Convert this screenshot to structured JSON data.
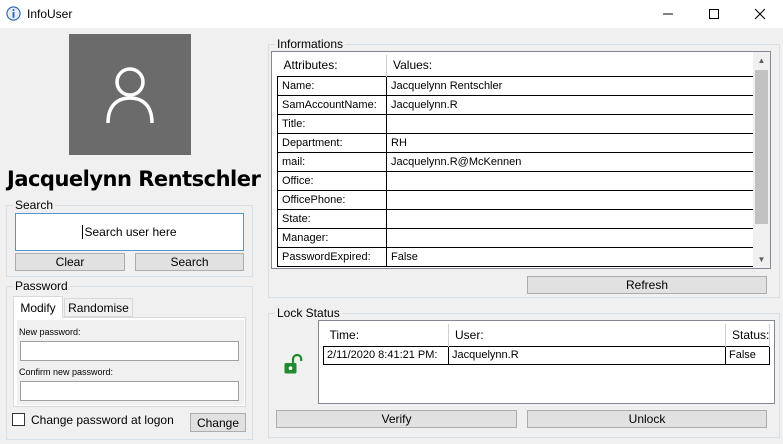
{
  "window": {
    "title": "InfoUser",
    "icon": "info-icon",
    "controls": [
      "minimize",
      "maximize",
      "close"
    ]
  },
  "user": {
    "avatar_icon": "user-silhouette-icon",
    "name": "Jacquelynn Rentschler"
  },
  "search": {
    "group_label": "Search",
    "placeholder": "Search user here",
    "clear_label": "Clear",
    "search_label": "Search"
  },
  "password": {
    "group_label": "Password",
    "tabs": [
      {
        "label": "Modify",
        "selected": true
      },
      {
        "label": "Randomise",
        "selected": false
      }
    ],
    "new_label": "New password:",
    "new_value": "",
    "confirm_label": "Confirm new password:",
    "confirm_value": "",
    "change_at_logon_label": "Change password at logon",
    "change_at_logon_checked": false,
    "change_label": "Change"
  },
  "informations": {
    "group_label": "Informations",
    "headers": [
      "Attributes:",
      "Values:"
    ],
    "rows": [
      {
        "attr": "Name:",
        "value": "Jacquelynn Rentschler"
      },
      {
        "attr": "SamAccountName:",
        "value": "Jacquelynn.R"
      },
      {
        "attr": "Title:",
        "value": ""
      },
      {
        "attr": "Department:",
        "value": "RH"
      },
      {
        "attr": "mail:",
        "value": "Jacquelynn.R@McKennen"
      },
      {
        "attr": "Office:",
        "value": ""
      },
      {
        "attr": "OfficePhone:",
        "value": ""
      },
      {
        "attr": "State:",
        "value": ""
      },
      {
        "attr": "Manager:",
        "value": ""
      },
      {
        "attr": "PasswordExpired:",
        "value": "False"
      }
    ],
    "refresh_label": "Refresh"
  },
  "lock_status": {
    "group_label": "Lock Status",
    "icon": "unlocked-padlock-icon",
    "headers": [
      "Time:",
      "User:",
      "Status:"
    ],
    "rows": [
      {
        "time": "2/11/2020 8:41:21 PM:",
        "user": "Jacquelynn.R",
        "status": "False"
      }
    ],
    "verify_label": "Verify",
    "unlock_label": "Unlock"
  },
  "colors": {
    "avatar_bg": "#6b6b6b",
    "focus_border": "#5a92d0",
    "lock_green": "#1f8a2e"
  }
}
